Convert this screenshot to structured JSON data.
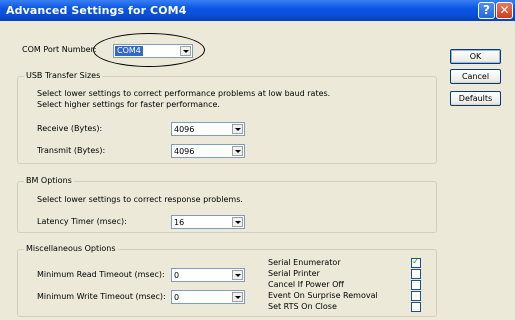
{
  "window": {
    "title": "Advanced Settings for COM4",
    "help_glyph": "?",
    "close_glyph": "✕"
  },
  "com_port": {
    "label": "COM Port Number:",
    "value": "COM4"
  },
  "buttons": {
    "ok": "OK",
    "cancel": "Cancel",
    "defaults": "Defaults"
  },
  "usb": {
    "legend": "USB Transfer Sizes",
    "line1": "Select lower settings to correct performance problems at low baud rates.",
    "line2": "Select higher settings for faster performance.",
    "receive_label": "Receive (Bytes):",
    "receive_value": "4096",
    "transmit_label": "Transmit (Bytes):",
    "transmit_value": "4096"
  },
  "bm": {
    "legend": "BM Options",
    "line1": "Select lower settings to correct response problems.",
    "latency_label": "Latency Timer (msec):",
    "latency_value": "16"
  },
  "misc": {
    "legend": "Miscellaneous Options",
    "min_read_label": "Minimum Read Timeout (msec):",
    "min_read_value": "0",
    "min_write_label": "Minimum Write Timeout (msec):",
    "min_write_value": "0",
    "options": [
      {
        "label": "Serial Enumerator",
        "checked": true,
        "mark": "✓"
      },
      {
        "label": "Serial Printer",
        "checked": false,
        "mark": ""
      },
      {
        "label": "Cancel If Power Off",
        "checked": false,
        "mark": ""
      },
      {
        "label": "Event On Surprise Removal",
        "checked": false,
        "mark": ""
      },
      {
        "label": "Set RTS On Close",
        "checked": false,
        "mark": ""
      }
    ]
  }
}
